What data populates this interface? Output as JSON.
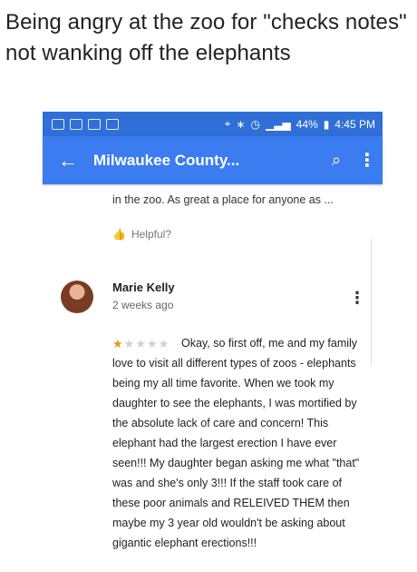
{
  "caption": "Being angry at the zoo for \"checks notes\" not wanking off the elephants",
  "statusbar": {
    "battery": "44%",
    "time": "4:45 PM"
  },
  "appbar": {
    "title": "Milwaukee County...",
    "back_icon": "arrow-left-icon",
    "search_icon": "search-icon",
    "more_icon": "more-vert-icon"
  },
  "previous_review": {
    "snippet": "in the zoo. As great a place for anyone as ...",
    "helpful": "Helpful?"
  },
  "review": {
    "name": "Marie Kelly",
    "time": "2 weeks ago",
    "rating": 1,
    "max_rating": 5,
    "text": "Okay, so first off, me and my family love to visit all different types of zoos - elephants being my all time favorite. When we took my daughter to see the elephants, I was mortified by the absolute lack of care and concern! This elephant had the largest erection I have ever seen!!! My daughter began asking me what \"that\" was and she's only 3!!! If the staff took care of these poor animals and RELEIVED THEM then maybe my 3 year old wouldn't be asking about gigantic elephant erections!!!"
  }
}
